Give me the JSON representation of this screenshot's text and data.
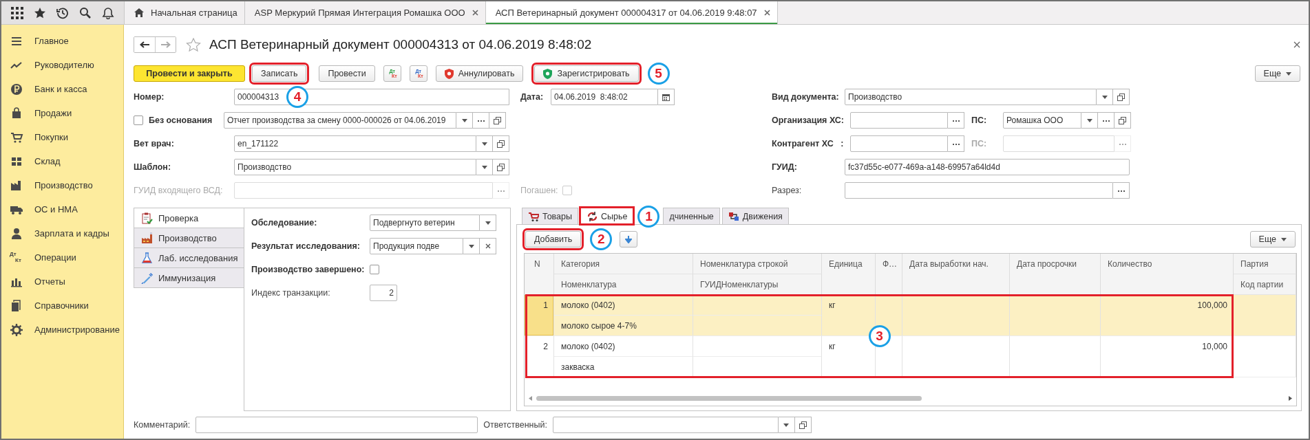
{
  "window_tabs": [
    {
      "kind": "home",
      "label": "Начальная страница",
      "selected": false
    },
    {
      "kind": "page",
      "label": "ASP Меркурий Прямая Интеграция Ромашка ООО",
      "selected": false
    },
    {
      "kind": "page",
      "label": "АСП Ветеринарный документ 000004317 от 04.06.2019 9:48:07",
      "selected": true
    }
  ],
  "sidebar": {
    "items": [
      {
        "label": "Главное"
      },
      {
        "label": "Руководителю"
      },
      {
        "label": "Банк и касса"
      },
      {
        "label": "Продажи"
      },
      {
        "label": "Покупки"
      },
      {
        "label": "Склад"
      },
      {
        "label": "Производство"
      },
      {
        "label": "ОС и НМА"
      },
      {
        "label": "Зарплата и кадры"
      },
      {
        "label": "Операции",
        "icon_text": [
          "Дт",
          "Кт"
        ]
      },
      {
        "label": "Отчеты"
      },
      {
        "label": "Справочники"
      },
      {
        "label": "Администрирование"
      }
    ]
  },
  "form": {
    "title": "АСП Ветеринарный документ 000004313 от 04.06.2019 8:48:02",
    "toolbar": [
      {
        "kind": "primary",
        "label": "Провести и закрыть",
        "highlighted": false
      },
      {
        "kind": "button",
        "label": "Записать",
        "highlighted": true
      },
      {
        "kind": "button",
        "label": "Провести",
        "highlighted": false
      },
      {
        "kind": "dtkt",
        "top": "Дт",
        "bottom": "Кт",
        "color": "#1f9a3a"
      },
      {
        "kind": "dtkt",
        "top": "Дт",
        "bottom": "Кт",
        "color": "#2a63c4"
      },
      {
        "kind": "shield",
        "label": "Аннулировать",
        "color": "#e0392e",
        "highlighted": false
      },
      {
        "kind": "shield",
        "label": "Зарегистрировать",
        "color": "#1ea45a",
        "highlighted": true,
        "callout": "5"
      }
    ],
    "more": "Еще",
    "number": {
      "label": "Номер:",
      "bold": true,
      "value": "000004313",
      "callout": "4"
    },
    "date": {
      "label": "Дата:",
      "bold": true,
      "value": "04.06.2019  8:48:02"
    },
    "basis": {
      "label": "Без основания",
      "bold": true,
      "checked": false,
      "value": "Отчет производства за смену 0000-000026 от 04.06.2019",
      "dropdown": true,
      "choose": true,
      "open": true
    },
    "vet": {
      "label": "Вет врач:",
      "bold": true,
      "value": "en_171122",
      "dropdown": true,
      "open": true
    },
    "template": {
      "label": "Шаблон:",
      "bold": true,
      "value": "Производство",
      "dropdown": true,
      "open": true
    },
    "incoming_guid": {
      "label": "ГУИД входящего ВСД:",
      "bold": false,
      "disabled": true,
      "choose": true
    },
    "repaid": {
      "label": "Погашен:",
      "checked": false,
      "disabled": true
    },
    "doc_type": {
      "label": "Вид документа:",
      "bold": true,
      "value": "Производство",
      "dropdown": true,
      "open": true
    },
    "org": {
      "label": "Организация ХС:",
      "bold": true,
      "choose": true
    },
    "org_ps": {
      "label": "ПС:",
      "bold": true,
      "value": "Ромашка ООО",
      "dropdown": true,
      "choose": true,
      "open": true
    },
    "counterparty": {
      "label": "Контрагент ХС   :",
      "bold": true,
      "choose": true
    },
    "counterparty_ps": {
      "label": "ПС:",
      "bold": true,
      "disabled": true,
      "choose": true
    },
    "guid": {
      "label": "ГУИД:",
      "bold": true,
      "value": "fc37d55c-e077-469a-a148-69957a64ld4d"
    },
    "section": {
      "label": "Разрез:",
      "bold": false,
      "choose": true
    },
    "subtabs": [
      {
        "label": "Проверка",
        "selected": true
      },
      {
        "label": "Производство",
        "selected": false
      },
      {
        "label": "Лаб. исследования",
        "selected": false
      },
      {
        "label": "Иммунизация",
        "selected": false
      }
    ],
    "check_fields": [
      {
        "kind": "select",
        "label": "Обследование:",
        "bold": true,
        "value": "Подвергнуто ветерин",
        "dropdown": true
      },
      {
        "kind": "select",
        "label": "Результат исследования:",
        "bold": true,
        "value": "Продукция подве",
        "dropdown": true,
        "clear": true
      },
      {
        "kind": "checkbox",
        "label": "Производство завершено:",
        "bold": true,
        "checked": false
      },
      {
        "kind": "number",
        "label": "Индекс транзакции:",
        "bold": false,
        "value": "2"
      }
    ],
    "content_tabs": [
      {
        "label": "Товары",
        "selected": false,
        "highlighted": false
      },
      {
        "label": "Сырье",
        "selected": true,
        "highlighted": true,
        "callout": "1"
      },
      {
        "label": "дчиненные",
        "selected": false,
        "highlighted": false
      },
      {
        "label": "Движения",
        "selected": false,
        "highlighted": false
      }
    ],
    "add_button": {
      "label": "Добавить",
      "highlighted": true,
      "callout": "2"
    },
    "table_more": "Еще",
    "table": {
      "columns": [
        {
          "top": "N"
        },
        {
          "top": "Категория",
          "bottom": "Номенклатура"
        },
        {
          "top": "Номенклатура строкой",
          "bottom": "ГУИДНоменклатуры"
        },
        {
          "top": "Единица"
        },
        {
          "top": "Ф…"
        },
        {
          "top": "Дата выработки нач."
        },
        {
          "top": "Дата просрочки"
        },
        {
          "top": "Количество"
        },
        {
          "top": "Партия",
          "bottom": "Код партии"
        }
      ],
      "rows": [
        {
          "selected": true,
          "n": "1",
          "category": "молоко (0402)",
          "nomenclature": "молоко сырое 4-7%",
          "unit": "кг",
          "quantity": "100,000"
        },
        {
          "selected": false,
          "n": "2",
          "category": "молоко (0402)",
          "nomenclature": "закваска",
          "unit": "кг",
          "quantity": "10,000"
        }
      ],
      "highlight": {
        "callout": "3"
      }
    },
    "comment": {
      "label": "Комментарий:"
    },
    "responsible": {
      "label": "Ответственный:",
      "dropdown": true,
      "open": true
    }
  }
}
